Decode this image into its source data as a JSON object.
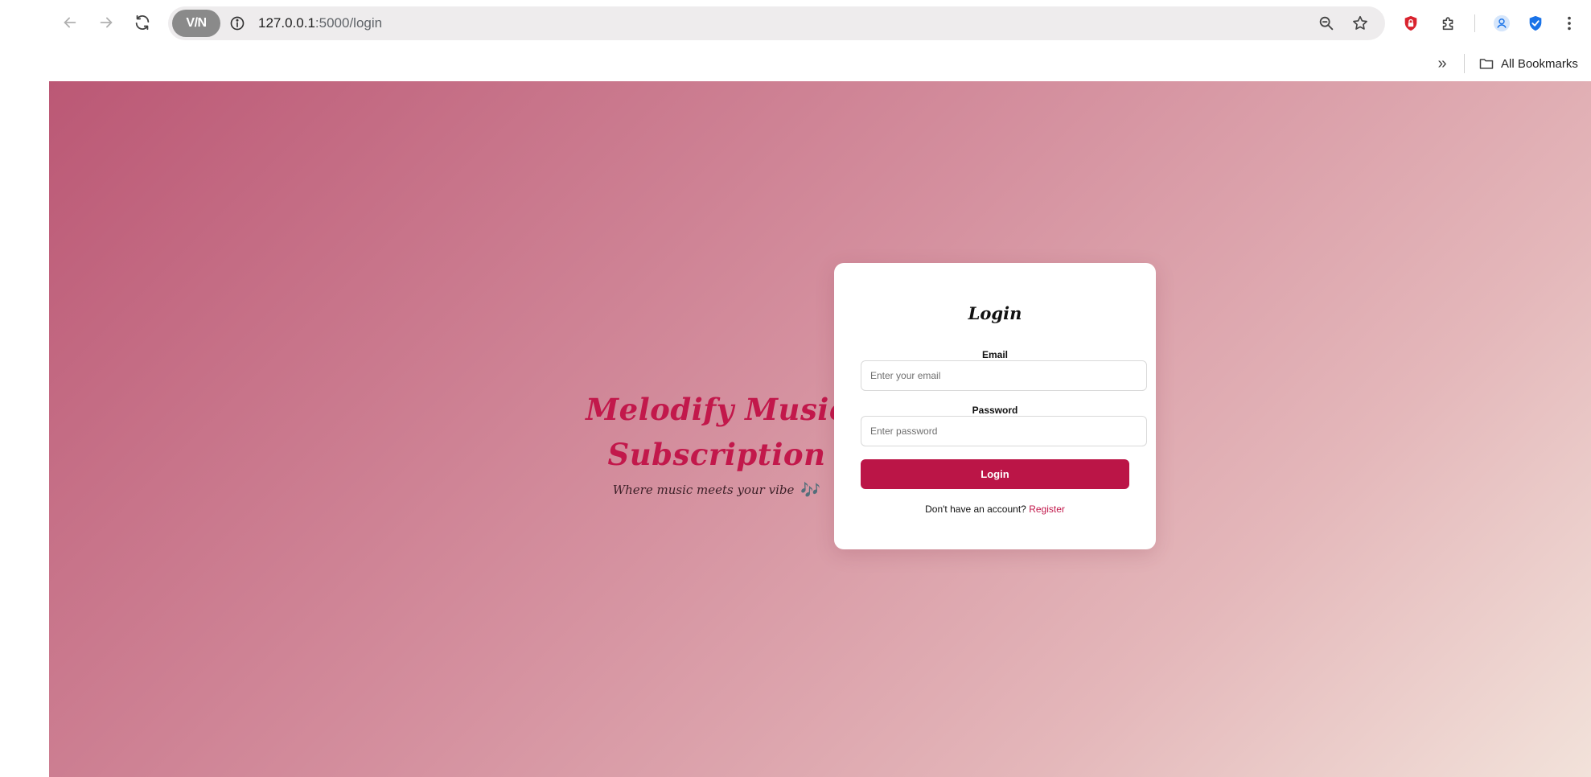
{
  "browser": {
    "url_host": "127.0.0.1",
    "url_path": ":5000/login",
    "vpn_label": "V/N",
    "bookmarks_chevron": "»",
    "all_bookmarks_label": "All Bookmarks",
    "icons": {
      "back": "arrow-left-icon",
      "forward": "arrow-right-icon",
      "reload": "reload-icon",
      "site_info": "info-icon",
      "zoom": "zoom-icon",
      "bookmark_star": "star-icon",
      "extension_red": "lock-extension-icon",
      "extensions": "puzzle-icon",
      "profile": "profile-icon",
      "shield": "shield-check-icon",
      "menu": "kebab-menu-icon",
      "folder": "folder-icon"
    }
  },
  "brand": {
    "title_line1": "Melodify Music",
    "title_line2": "Subscription",
    "tagline": "Where music meets your vibe",
    "tagline_icon": "🎶"
  },
  "login": {
    "title": "Login",
    "email_label": "Email",
    "email_placeholder": "Enter your email",
    "email_value": "",
    "password_label": "Password",
    "password_placeholder": "Enter password",
    "password_value": "",
    "submit_label": "Login",
    "register_prompt": "Don't have an account?",
    "register_link": "Register"
  },
  "colors": {
    "accent": "#bb1547",
    "brand_text": "#c2184b",
    "gradient_start": "#bb5875",
    "gradient_end": "#f2e2da"
  }
}
